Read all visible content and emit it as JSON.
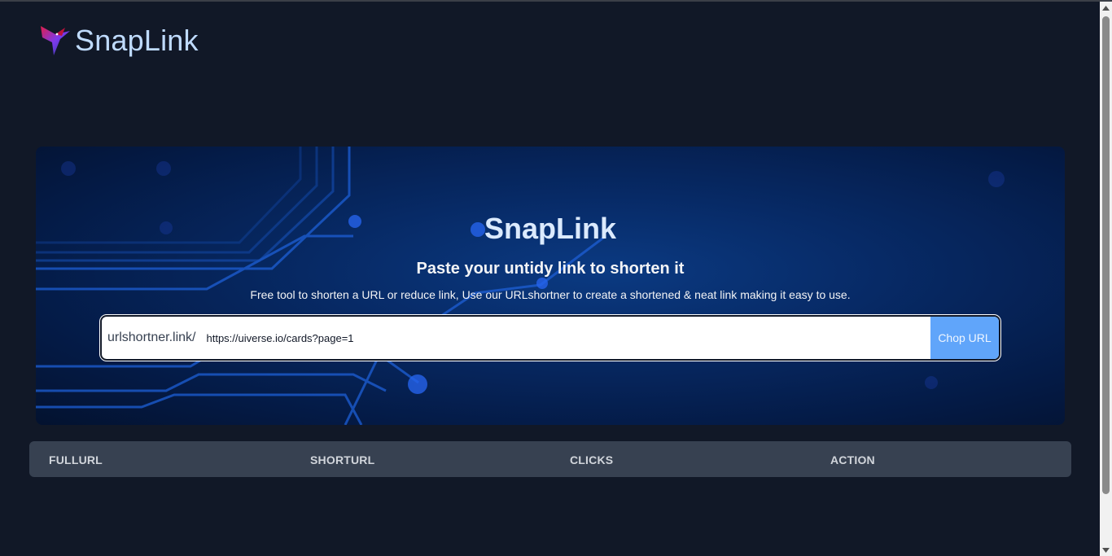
{
  "brand": {
    "name": "SnapLink",
    "logo_icon": "hummingbird-logo-icon"
  },
  "hero": {
    "title": "SnapLink",
    "subtitle": "Paste your untidy link to shorten it",
    "description": "Free tool to shorten a URL or reduce link, Use our URLshortner to create a shortened & neat link making it easy to use."
  },
  "form": {
    "prefix": "urlshortner.link/",
    "url_value": "https://uiverse.io/cards?page=1",
    "submit_label": "Chop URL"
  },
  "table": {
    "columns": [
      "FULLURL",
      "SHORTURL",
      "CLICKS",
      "ACTION"
    ],
    "rows": []
  },
  "colors": {
    "background": "#111827",
    "accent": "#60a5fa",
    "brand_text": "#bfdbfe",
    "table_header": "#374151"
  }
}
